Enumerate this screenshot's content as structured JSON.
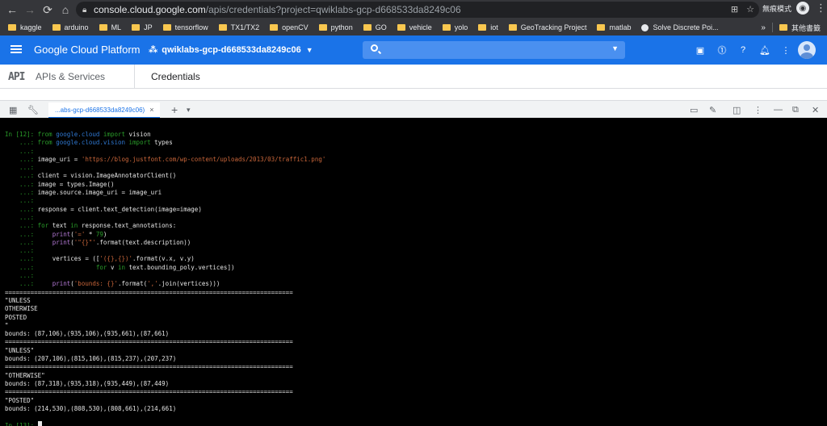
{
  "browser": {
    "url_host": "console.cloud.google.com",
    "url_path": "/apis/credentials?project=qwiklabs-gcp-d668533da8249c06",
    "profile_label": "無痕模式",
    "bookmarks": [
      "kaggle",
      "arduino",
      "ML",
      "JP",
      "tensorflow",
      "TX1/TX2",
      "openCV",
      "python",
      "GO",
      "vehicle",
      "yolo",
      "iot",
      "GeoTracking Project",
      "matlab"
    ],
    "bookmark_special": "Solve Discrete Poi...",
    "more_label": "»",
    "other_bookmarks": "其他書籤"
  },
  "gcp": {
    "title": "Google Cloud Platform",
    "project": "qwiklabs-gcp-d668533da8249c06",
    "section": "APIs & Services",
    "api_logo": "API",
    "page_title": "Credentials"
  },
  "shell": {
    "tab_label": "...abs-gcp-d668533da8249c06)",
    "tab_close": "×",
    "add_tab": "+",
    "tab_menu": "▾"
  },
  "terminal": {
    "lines": [
      {
        "p": "In [12]: ",
        "pt": "in",
        "segs": [
          [
            "kw",
            "from "
          ],
          [
            "mod",
            "google.cloud"
          ],
          [
            "kw",
            " import "
          ],
          [
            "t",
            "vision"
          ]
        ]
      },
      {
        "p": "    ...: ",
        "pt": "cont",
        "segs": [
          [
            "kw",
            "from "
          ],
          [
            "mod",
            "google.cloud.vision"
          ],
          [
            "kw",
            " import "
          ],
          [
            "t",
            "types"
          ]
        ]
      },
      {
        "p": "    ...: ",
        "pt": "cont",
        "segs": []
      },
      {
        "p": "    ...: ",
        "pt": "cont",
        "segs": [
          [
            "t",
            "image_uri = "
          ],
          [
            "str",
            "'https://blog.justfont.com/wp-content/uploads/2013/03/traffic1.png'"
          ]
        ]
      },
      {
        "p": "    ...: ",
        "pt": "cont",
        "segs": []
      },
      {
        "p": "    ...: ",
        "pt": "cont",
        "segs": [
          [
            "t",
            "client = vision.ImageAnnotatorClient()"
          ]
        ]
      },
      {
        "p": "    ...: ",
        "pt": "cont",
        "segs": [
          [
            "t",
            "image = types.Image()"
          ]
        ]
      },
      {
        "p": "    ...: ",
        "pt": "cont",
        "segs": [
          [
            "t",
            "image.source.image_uri = image_uri"
          ]
        ]
      },
      {
        "p": "    ...: ",
        "pt": "cont",
        "segs": []
      },
      {
        "p": "    ...: ",
        "pt": "cont",
        "segs": [
          [
            "t",
            "response = client.text_detection(image=image)"
          ]
        ]
      },
      {
        "p": "    ...: ",
        "pt": "cont",
        "segs": []
      },
      {
        "p": "    ...: ",
        "pt": "cont",
        "segs": [
          [
            "kw",
            "for "
          ],
          [
            "t",
            "text "
          ],
          [
            "kw",
            "in "
          ],
          [
            "t",
            "response.text_annotations:"
          ]
        ]
      },
      {
        "p": "    ...: ",
        "pt": "cont",
        "segs": [
          [
            "t",
            "    "
          ],
          [
            "fn",
            "print"
          ],
          [
            "t",
            "("
          ],
          [
            "str",
            "'='"
          ],
          [
            "t",
            " * "
          ],
          [
            "num",
            "79"
          ],
          [
            "t",
            ")"
          ]
        ]
      },
      {
        "p": "    ...: ",
        "pt": "cont",
        "segs": [
          [
            "t",
            "    "
          ],
          [
            "fn",
            "print"
          ],
          [
            "t",
            "("
          ],
          [
            "str",
            "'\"{}\"'"
          ],
          [
            "t",
            ".format(text.description))"
          ]
        ]
      },
      {
        "p": "    ...: ",
        "pt": "cont",
        "segs": []
      },
      {
        "p": "    ...: ",
        "pt": "cont",
        "segs": [
          [
            "t",
            "    vertices = (["
          ],
          [
            "str",
            "'({},{})'"
          ],
          [
            "t",
            ".format(v.x, v.y)"
          ]
        ]
      },
      {
        "p": "    ...: ",
        "pt": "cont",
        "segs": [
          [
            "t",
            "                "
          ],
          [
            "kw",
            "for "
          ],
          [
            "t",
            "v "
          ],
          [
            "kw",
            "in "
          ],
          [
            "t",
            "text.bounding_poly.vertices])"
          ]
        ]
      },
      {
        "p": "    ...: ",
        "pt": "cont",
        "segs": []
      },
      {
        "p": "    ...: ",
        "pt": "cont",
        "segs": [
          [
            "t",
            "    "
          ],
          [
            "fn",
            "print"
          ],
          [
            "t",
            "("
          ],
          [
            "str",
            "'bounds: {}'"
          ],
          [
            "t",
            ".format("
          ],
          [
            "str",
            "','"
          ],
          [
            "t",
            ".join(vertices)))"
          ]
        ]
      },
      {
        "p": "",
        "pt": "",
        "segs": [
          [
            "t",
            "==============================================================================="
          ]
        ]
      },
      {
        "p": "",
        "pt": "",
        "segs": [
          [
            "t",
            "\"UNLESS"
          ]
        ]
      },
      {
        "p": "",
        "pt": "",
        "segs": [
          [
            "t",
            "OTHERWISE"
          ]
        ]
      },
      {
        "p": "",
        "pt": "",
        "segs": [
          [
            "t",
            "POSTED"
          ]
        ]
      },
      {
        "p": "",
        "pt": "",
        "segs": [
          [
            "t",
            "\""
          ]
        ]
      },
      {
        "p": "",
        "pt": "",
        "segs": [
          [
            "t",
            "bounds: (87,106),(935,106),(935,661),(87,661)"
          ]
        ]
      },
      {
        "p": "",
        "pt": "",
        "segs": [
          [
            "t",
            "==============================================================================="
          ]
        ]
      },
      {
        "p": "",
        "pt": "",
        "segs": [
          [
            "t",
            "\"UNLESS\""
          ]
        ]
      },
      {
        "p": "",
        "pt": "",
        "segs": [
          [
            "t",
            "bounds: (207,106),(815,106),(815,237),(207,237)"
          ]
        ]
      },
      {
        "p": "",
        "pt": "",
        "segs": [
          [
            "t",
            "==============================================================================="
          ]
        ]
      },
      {
        "p": "",
        "pt": "",
        "segs": [
          [
            "t",
            "\"OTHERWISE\""
          ]
        ]
      },
      {
        "p": "",
        "pt": "",
        "segs": [
          [
            "t",
            "bounds: (87,318),(935,318),(935,449),(87,449)"
          ]
        ]
      },
      {
        "p": "",
        "pt": "",
        "segs": [
          [
            "t",
            "==============================================================================="
          ]
        ]
      },
      {
        "p": "",
        "pt": "",
        "segs": [
          [
            "t",
            "\"POSTED\""
          ]
        ]
      },
      {
        "p": "",
        "pt": "",
        "segs": [
          [
            "t",
            "bounds: (214,530),(808,530),(808,661),(214,661)"
          ]
        ]
      },
      {
        "p": "",
        "pt": "",
        "segs": []
      },
      {
        "p": "In [13]: ",
        "pt": "in",
        "segs": [],
        "cursor": true
      }
    ]
  }
}
